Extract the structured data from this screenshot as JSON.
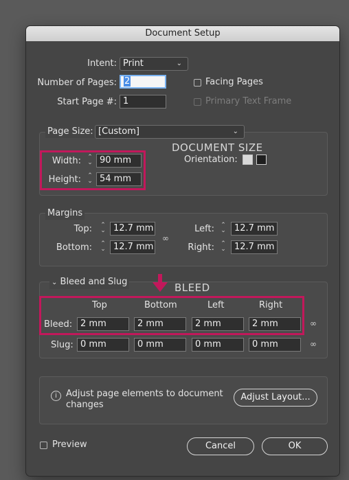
{
  "dialog": {
    "title": "Document Setup"
  },
  "intent": {
    "label": "Intent:",
    "value": "Print"
  },
  "number_of_pages": {
    "label": "Number of Pages:",
    "value": "2"
  },
  "start_page": {
    "label": "Start Page #:",
    "value": "1"
  },
  "facing_pages": {
    "label": "Facing Pages",
    "checked": false
  },
  "primary_text_frame": {
    "label": "Primary Text Frame",
    "checked": false,
    "enabled": false
  },
  "page_size": {
    "label": "Page Size:",
    "value": "[Custom]"
  },
  "width": {
    "label": "Width:",
    "value": "90 mm"
  },
  "height": {
    "label": "Height:",
    "value": "54 mm"
  },
  "orientation": {
    "label": "Orientation:",
    "selected": "landscape"
  },
  "margins": {
    "title": "Margins",
    "top": {
      "label": "Top:",
      "value": "12.7 mm"
    },
    "bottom": {
      "label": "Bottom:",
      "value": "12.7 mm"
    },
    "left": {
      "label": "Left:",
      "value": "12.7 mm"
    },
    "right": {
      "label": "Right:",
      "value": "12.7 mm"
    }
  },
  "bleed_slug": {
    "title": "Bleed and Slug",
    "columns": [
      "Top",
      "Bottom",
      "Left",
      "Right"
    ],
    "bleed": {
      "label": "Bleed:",
      "values": [
        "2 mm",
        "2 mm",
        "2 mm",
        "2 mm"
      ]
    },
    "slug": {
      "label": "Slug:",
      "values": [
        "0 mm",
        "0 mm",
        "0 mm",
        "0 mm"
      ]
    }
  },
  "annotations": {
    "document_size": "DOCUMENT SIZE",
    "bleed": "BLEED",
    "highlight_color": "#c2185b"
  },
  "adjust": {
    "text": "Adjust page elements to document changes",
    "button": "Adjust Layout..."
  },
  "preview": {
    "label": "Preview",
    "checked": false
  },
  "buttons": {
    "cancel": "Cancel",
    "ok": "OK"
  },
  "icons": {
    "chevron": "chevron-down-icon",
    "spinner": "spinner-arrows-icon",
    "link": "chain-link-icon",
    "info": "info-icon"
  }
}
